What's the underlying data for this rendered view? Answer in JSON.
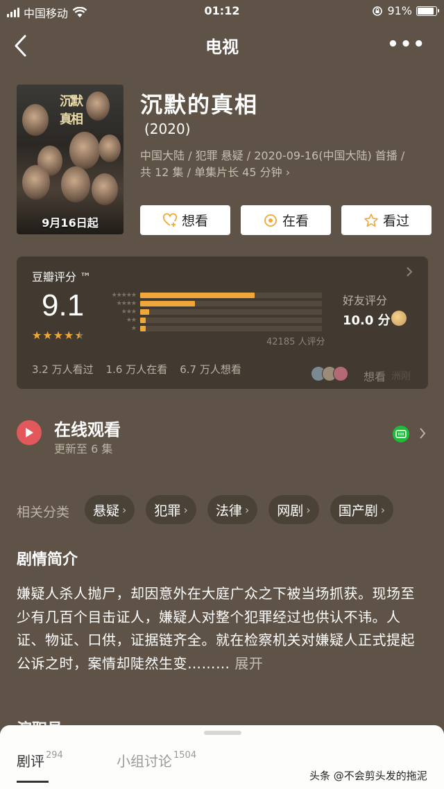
{
  "status_bar": {
    "carrier": "中国移动",
    "time": "01:12",
    "battery": "91%"
  },
  "nav": {
    "title": "电视",
    "more": "•••"
  },
  "show": {
    "title": "沉默的真相",
    "year": "(2020)",
    "meta_line1": "中国大陆 / 犯罪 悬疑 / 2020-09-16(中国大陆) 首播 /",
    "meta_line2": "共 12 集 / 单集片长 45 分钟 ›",
    "poster_date": "9月16日起"
  },
  "actions": [
    {
      "label": "想看",
      "icon": "heart-plus-icon"
    },
    {
      "label": "在看",
      "icon": "target-icon"
    },
    {
      "label": "看过",
      "icon": "star-outline-icon"
    }
  ],
  "rating": {
    "label": "豆瓣评分 ™",
    "score": "9.1",
    "stars": 4.5,
    "distribution": [
      {
        "stars": 5,
        "fraction": 0.63
      },
      {
        "stars": 4,
        "fraction": 0.3
      },
      {
        "stars": 3,
        "fraction": 0.05
      },
      {
        "stars": 2,
        "fraction": 0.03
      },
      {
        "stars": 1,
        "fraction": 0.03
      }
    ],
    "count_text": "42185 人评分",
    "friend_label": "好友评分",
    "friend_score": "10.0 分",
    "watched": "3.2 万人看过",
    "watching": "1.6 万人在看",
    "wanting": "6.7 万人想看",
    "friends_want": "想看",
    "faint_text": "洲刚",
    "accent": "#f0a73a"
  },
  "online": {
    "title": "在线观看",
    "subtitle": "更新至 6 集",
    "platform": "iQIYI"
  },
  "categories": {
    "label": "相关分类",
    "items": [
      "悬疑",
      "犯罪",
      "法律",
      "网剧",
      "国产剧"
    ]
  },
  "synopsis": {
    "heading": "剧情简介",
    "text": "嫌疑人杀人抛尸，却因意外在大庭广众之下被当场抓获。现场至少有几百个目击证人，嫌疑人对整个犯罪经过也供认不讳。人证、物证、口供，证据链齐全。就在检察机关对嫌疑人正式提起公诉之时，案情却陡然生变……… ",
    "expand": "展开",
    "next_heading_partial": "演职员"
  },
  "sheet": {
    "tab1_label": "剧评",
    "tab1_count": "294",
    "tab2_label": "小组讨论",
    "tab2_count": "1504"
  },
  "watermark": "头条 @不会剪头发的拖泥"
}
